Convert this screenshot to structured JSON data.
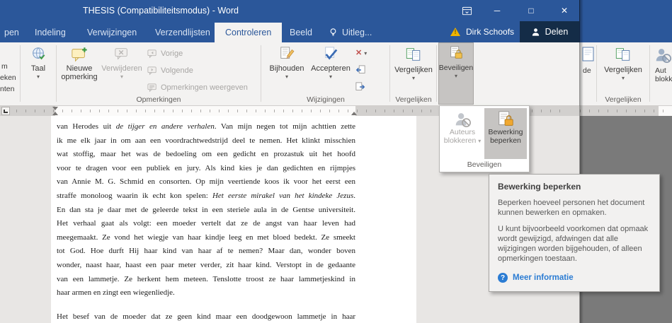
{
  "colors": {
    "titlebar_blue": "#2b579a",
    "ribbon_grey": "#f3f2f1",
    "pressed_grey": "#c6c4c2",
    "link_blue": "#2b7cd3",
    "warning_yellow": "#f0b400",
    "lock_orange": "#f0a830",
    "bg_window_doc_grey": "#7a7a7a"
  },
  "icons": {
    "caret": "▾",
    "chevron_up": "∧",
    "minimize": "─",
    "maximize": "□",
    "close": "✕",
    "reject": "✕",
    "warning_mark": "!",
    "question": "?"
  },
  "titlebar": {
    "title": "THESIS (Compatibiliteitsmodus) - Word"
  },
  "tabs": {
    "items": [
      {
        "label": "pen"
      },
      {
        "label": "Indeling"
      },
      {
        "label": "Verwijzingen"
      },
      {
        "label": "Verzendlijsten"
      },
      {
        "label": "Controleren",
        "active": true
      },
      {
        "label": "Beeld"
      }
    ],
    "tell_me": "Uitleg...",
    "account": "Dirk Schoofs",
    "share": "Delen"
  },
  "ribbon": {
    "left_fragments": [
      "m",
      "eken",
      "nten"
    ],
    "taal": {
      "label": "Taal"
    },
    "opmerkingen_group": {
      "label": "Opmerkingen",
      "nieuwe_opmerking": {
        "line1": "Nieuwe",
        "line2": "opmerking"
      },
      "verwijderen": {
        "label": "Verwijderen"
      },
      "vorige": {
        "label": "Vorige"
      },
      "volgende": {
        "label": "Volgende"
      },
      "opmerkingen_weergeven": {
        "label": "Opmerkingen weergeven"
      }
    },
    "wijzigingen_group": {
      "label": "Wijzigingen",
      "bijhouden": {
        "label": "Bijhouden"
      },
      "accepteren": {
        "label": "Accepteren"
      }
    },
    "vergelijken_group": {
      "label": "Vergelijken",
      "vergelijken": {
        "label": "Vergelijken"
      }
    },
    "beveiligen_group": {
      "beveiligen": {
        "label": "Beveiligen"
      }
    }
  },
  "beveiligen_menu": {
    "auteurs_blokkeren": {
      "line1": "Auteurs",
      "line2": "blokkeren"
    },
    "bewerking_beperken": {
      "line1": "Bewerking",
      "line2": "beperken"
    },
    "group_label": "Beveiligen"
  },
  "tooltip": {
    "title": "Bewerking beperken",
    "body1": "Beperken hoeveel personen het document kunnen bewerken en opmaken.",
    "body2": "U kunt bijvoorbeeld voorkomen dat opmaak wordt gewijzigd, afdwingen dat alle wijzigingen worden bijgehouden, of alleen opmerkingen toestaan.",
    "link": "Meer informatie"
  },
  "background_window": {
    "fragment_label": "de",
    "vergelijken": {
      "label": "Vergelijken",
      "group_label": "Vergelijken"
    },
    "partial_button": {
      "line1": "Aut",
      "line2": "blokk"
    }
  },
  "document": {
    "lines": [
      {
        "pre": "van Herodes uit ",
        "it": "de tijger en andere verhalen",
        "post": ". Van mijn negen tot mijn achttien zette"
      },
      {
        "pre": "ik me elk jaar in om aan een voordrachtwedstrijd deel te nemen. Het klinkt misschien"
      },
      {
        "pre": "wat stoffig, maar het was de bedoeling om een gedicht en prozastuk uit het hoofd"
      },
      {
        "pre": "voor te dragen voor een publiek en jury. Als kind kies je dan gedichten en rijmpjes"
      },
      {
        "pre": "van Annie M. G. Schmid en consorten. Op mijn veertiende koos ik voor het eerst een"
      },
      {
        "pre": "straffe monoloog waarin ik echt kon spelen: ",
        "it": "Het eerste mirakel van het kindeke Jezus",
        "post": "."
      },
      {
        "pre": "En dan sta je daar met de geleerde tekst in een steriele aula in de Gentse universiteit."
      },
      {
        "pre": "Het verhaal gaat als volgt: een moeder vertelt dat ze de angst van haar leven had"
      },
      {
        "pre": "meegemaakt. Ze vond het wiegje van haar kindje leeg en met bloed bedekt. Ze smeekt"
      },
      {
        "pre": "tot God. Hoe durft Hij haar kind van haar af te nemen? Maar dan, wonder boven"
      },
      {
        "pre": "wonder, naast haar, haast een paar meter verder, zit haar kind. Verstopt in de gedaante"
      },
      {
        "pre": "van een lammetje. Ze herkent hem meteen. Tenslotte troost ze haar lammetjeskind in"
      },
      {
        "pre": "haar armen en zingt een wiegenliedje."
      },
      {
        "pre": "Het besef van de moeder dat ze geen kind maar een doodgewoon lammetje in haar"
      }
    ]
  }
}
